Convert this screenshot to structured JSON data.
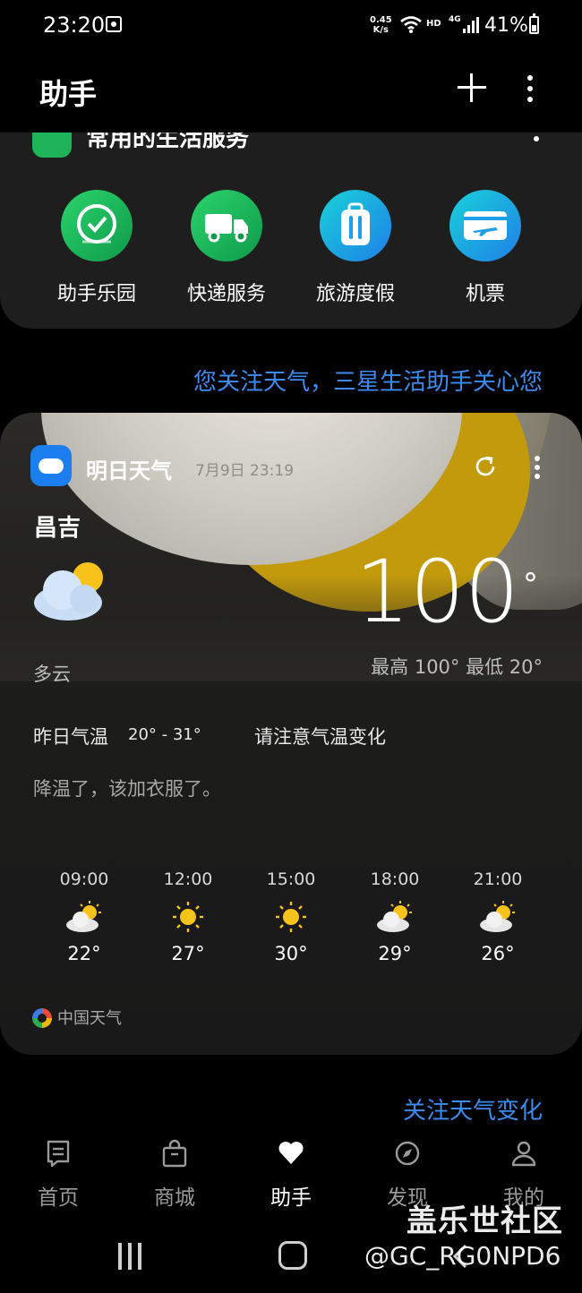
{
  "status_bar": {
    "time": "23:20",
    "speed_value": "0.45",
    "speed_unit": "K/s",
    "hd": "HD",
    "network": "4G",
    "battery": "41%"
  },
  "app_bar": {
    "title": "助手"
  },
  "services": {
    "header": "常用的生活服务",
    "items": [
      {
        "label": "助手乐园",
        "icon": "clock-check-icon"
      },
      {
        "label": "快递服务",
        "icon": "truck-icon"
      },
      {
        "label": "旅游度假",
        "icon": "luggage-icon"
      },
      {
        "label": "机票",
        "icon": "airplane-ticket-icon"
      }
    ]
  },
  "follow_tip": "您关注天气，三星生活助手关心您",
  "weather": {
    "header": "明日天气",
    "updated": "7月9日 23:19",
    "city": "昌吉",
    "temperature": "100",
    "degree": "°",
    "condition": "多云",
    "high_low": "最高 100° 最低 20°",
    "yesterday_label": "昨日气温",
    "yesterday_range": "20° - 31°",
    "notice": "请注意气温变化",
    "tip": "降温了，该加衣服了。",
    "hourly": [
      {
        "time": "09:00",
        "temp": "22°",
        "icon": "partly-cloudy-icon"
      },
      {
        "time": "12:00",
        "temp": "27°",
        "icon": "sun-icon"
      },
      {
        "time": "15:00",
        "temp": "30°",
        "icon": "sun-icon"
      },
      {
        "time": "18:00",
        "temp": "29°",
        "icon": "partly-cloudy-icon"
      },
      {
        "time": "21:00",
        "temp": "26°",
        "icon": "partly-cloudy-icon"
      }
    ],
    "source": "中国天气"
  },
  "follow_weather": "关注天气变化",
  "bottom_nav": [
    {
      "label": "首页",
      "icon": "home-book-icon",
      "active": false
    },
    {
      "label": "商城",
      "icon": "shopping-bag-icon",
      "active": false
    },
    {
      "label": "助手",
      "icon": "heart-icon",
      "active": true
    },
    {
      "label": "发现",
      "icon": "compass-icon",
      "active": false
    },
    {
      "label": "我的",
      "icon": "person-icon",
      "active": false
    }
  ],
  "watermark": {
    "line1": "盖乐世社区",
    "line2": "@GC_RG0NPD6"
  },
  "colors": {
    "accent": "#3b8bf0",
    "service_green": "#1fb45a",
    "weather_blue": "#1d7ef0",
    "sun_yellow": "#f7c21a"
  }
}
